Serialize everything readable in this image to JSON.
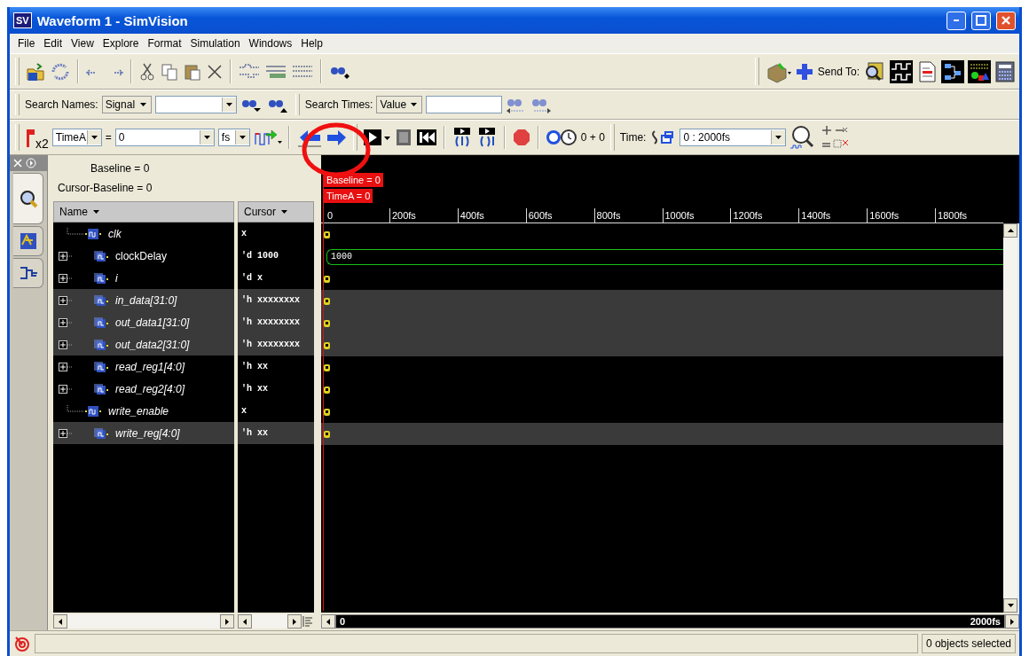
{
  "window": {
    "badge": "SV",
    "title": "Waveform 1 - SimVision"
  },
  "menu": [
    {
      "label": "File"
    },
    {
      "label": "Edit"
    },
    {
      "label": "View"
    },
    {
      "label": "Explore"
    },
    {
      "label": "Format"
    },
    {
      "label": "Simulation"
    },
    {
      "label": "Windows"
    },
    {
      "label": "Help"
    }
  ],
  "send_to": {
    "label": "Send To:"
  },
  "search": {
    "names_label": "Search Names:",
    "names_type": "Signal",
    "times_label": "Search Times:",
    "times_type": "Value"
  },
  "time_bar": {
    "cursor_badge": "x2",
    "marker": "TimeA",
    "equals": "=",
    "value": "0",
    "unit": "fs",
    "sim_time": "0 + 0",
    "time_label": "Time:",
    "range": "0 : 2000fs"
  },
  "side_tabs": [
    {
      "selected": true
    },
    {
      "selected": false
    },
    {
      "selected": false
    }
  ],
  "info": {
    "baseline": "Baseline = 0",
    "cursor_baseline": "Cursor-Baseline = 0"
  },
  "columns": [
    {
      "label": "Name"
    },
    {
      "label": "Cursor"
    }
  ],
  "rows": [
    {
      "name": "clk",
      "kind": "scalar",
      "italic": true,
      "selected": false,
      "cursor": "x",
      "trace": {
        "kind": "marker"
      }
    },
    {
      "name": "clockDelay",
      "kind": "bus",
      "italic": false,
      "selected": false,
      "cursor": "'d 1000",
      "trace": {
        "kind": "bus",
        "label": "1000"
      }
    },
    {
      "name": "i",
      "kind": "bus",
      "italic": true,
      "selected": false,
      "cursor": "'d x",
      "trace": {
        "kind": "marker"
      }
    },
    {
      "name": "in_data[31:0]",
      "kind": "bus",
      "italic": true,
      "selected": true,
      "cursor": "'h xxxxxxxx",
      "trace": {
        "kind": "marker"
      }
    },
    {
      "name": "out_data1[31:0]",
      "kind": "bus",
      "italic": true,
      "selected": true,
      "cursor": "'h xxxxxxxx",
      "trace": {
        "kind": "marker"
      }
    },
    {
      "name": "out_data2[31:0]",
      "kind": "bus",
      "italic": true,
      "selected": true,
      "cursor": "'h xxxxxxxx",
      "trace": {
        "kind": "marker"
      }
    },
    {
      "name": "read_reg1[4:0]",
      "kind": "bus",
      "italic": true,
      "selected": false,
      "cursor": "'h xx",
      "trace": {
        "kind": "marker"
      }
    },
    {
      "name": "read_reg2[4:0]",
      "kind": "bus",
      "italic": true,
      "selected": false,
      "cursor": "'h xx",
      "trace": {
        "kind": "marker"
      }
    },
    {
      "name": "write_enable",
      "kind": "scalar",
      "italic": true,
      "selected": false,
      "cursor": "x",
      "trace": {
        "kind": "marker"
      }
    },
    {
      "name": "write_reg[4:0]",
      "kind": "bus",
      "italic": true,
      "selected": true,
      "cursor": "'h xx",
      "trace": {
        "kind": "marker"
      }
    }
  ],
  "waveform": {
    "markers": [
      {
        "label": "Baseline = 0"
      },
      {
        "label": "TimeA = 0"
      }
    ],
    "ticks": [
      "0",
      "200fs",
      "400fs",
      "600fs",
      "800fs",
      "1000fs",
      "1200fs",
      "1400fs",
      "1600fs",
      "1800fs"
    ],
    "scroll_start": "0",
    "scroll_end": "2000fs"
  },
  "status_bar": {
    "text": "0 objects selected"
  }
}
